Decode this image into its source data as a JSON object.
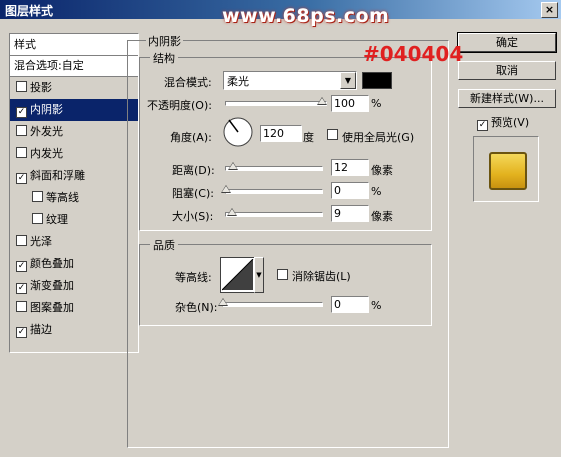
{
  "window": {
    "title": "图层样式",
    "watermark": "www.68ps.com",
    "close_label": "×"
  },
  "annotation": "#040404",
  "styles_panel": {
    "header": "样式",
    "blend_options": "混合选项:自定",
    "items": [
      {
        "label": "投影",
        "checked": false,
        "selected": false,
        "sub": false
      },
      {
        "label": "内阴影",
        "checked": true,
        "selected": true,
        "sub": false
      },
      {
        "label": "外发光",
        "checked": false,
        "selected": false,
        "sub": false
      },
      {
        "label": "内发光",
        "checked": false,
        "selected": false,
        "sub": false
      },
      {
        "label": "斜面和浮雕",
        "checked": true,
        "selected": false,
        "sub": false
      },
      {
        "label": "等高线",
        "checked": false,
        "selected": false,
        "sub": true
      },
      {
        "label": "纹理",
        "checked": false,
        "selected": false,
        "sub": true
      },
      {
        "label": "光泽",
        "checked": false,
        "selected": false,
        "sub": false
      },
      {
        "label": "颜色叠加",
        "checked": true,
        "selected": false,
        "sub": false
      },
      {
        "label": "渐变叠加",
        "checked": true,
        "selected": false,
        "sub": false
      },
      {
        "label": "图案叠加",
        "checked": false,
        "selected": false,
        "sub": false
      },
      {
        "label": "描边",
        "checked": true,
        "selected": false,
        "sub": false
      }
    ]
  },
  "buttons": {
    "ok": "确定",
    "cancel": "取消",
    "new_style": "新建样式(W)..."
  },
  "preview": {
    "label": "预览(V)",
    "checked": true
  },
  "inner_shadow": {
    "title": "内阴影",
    "structure": {
      "title": "结构",
      "blend_mode_label": "混合模式:",
      "blend_mode_value": "柔光",
      "shadow_color": "#000000",
      "opacity_label": "不透明度(O):",
      "opacity_value": "100",
      "opacity_unit": "%",
      "angle_label": "角度(A):",
      "angle_value": "120",
      "angle_unit": "度",
      "global_light_label": "使用全局光(G)",
      "global_light_checked": false,
      "distance_label": "距离(D):",
      "distance_value": "12",
      "distance_unit": "像素",
      "choke_label": "阻塞(C):",
      "choke_value": "0",
      "choke_unit": "%",
      "size_label": "大小(S):",
      "size_value": "9",
      "size_unit": "像素"
    },
    "quality": {
      "title": "品质",
      "contour_label": "等高线:",
      "anti_alias_label": "消除锯齿(L)",
      "anti_alias_checked": false,
      "noise_label": "杂色(N):",
      "noise_value": "0",
      "noise_unit": "%"
    }
  }
}
